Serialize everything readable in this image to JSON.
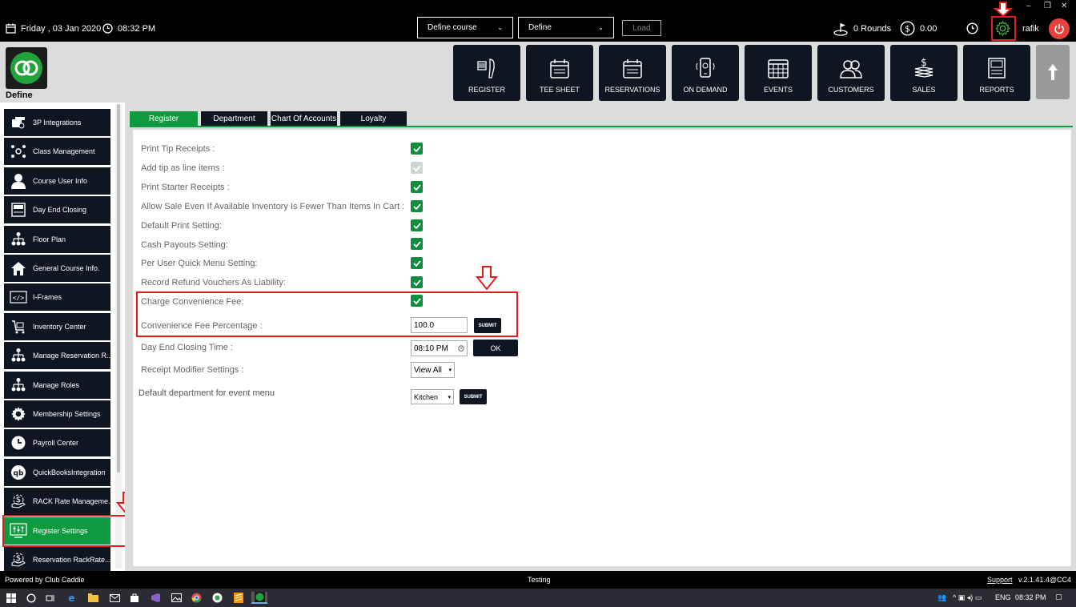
{
  "topbar": {
    "date": "Friday ,  03 Jan 2020",
    "time": "08:32 PM",
    "course_select": "Define  course",
    "define_select": "Define",
    "load_label": "Load",
    "rounds": "0 Rounds",
    "amount": "0.00",
    "user": "rafik"
  },
  "header": {
    "logo_label": "Define",
    "nav": [
      {
        "label": "REGISTER",
        "icon": "barcode-scanner-icon"
      },
      {
        "label": "TEE SHEET",
        "icon": "calendar-icon"
      },
      {
        "label": "RESERVATIONS",
        "icon": "calendar-icon"
      },
      {
        "label": "ON DEMAND",
        "icon": "mobile-icon"
      },
      {
        "label": "EVENTS",
        "icon": "events-calendar-icon"
      },
      {
        "label": "CUSTOMERS",
        "icon": "users-icon"
      },
      {
        "label": "SALES",
        "icon": "money-icon"
      },
      {
        "label": "REPORTS",
        "icon": "report-icon"
      }
    ]
  },
  "sidebar": {
    "items": [
      {
        "label": "3P Integrations",
        "icon": "integration-icon"
      },
      {
        "label": "Class Management",
        "icon": "class-icon"
      },
      {
        "label": "Course User Info",
        "icon": "user-icon"
      },
      {
        "label": "Day End Closing",
        "icon": "register-icon"
      },
      {
        "label": "Floor Plan",
        "icon": "hierarchy-icon"
      },
      {
        "label": "General Course Info.",
        "icon": "home-icon"
      },
      {
        "label": "I-Frames",
        "icon": "code-icon"
      },
      {
        "label": "Inventory Center",
        "icon": "inventory-icon"
      },
      {
        "label": "Manage Reservation R...",
        "icon": "hierarchy-icon"
      },
      {
        "label": "Manage Roles",
        "icon": "hierarchy-icon"
      },
      {
        "label": "Membership Settings",
        "icon": "gear-icon"
      },
      {
        "label": "Payroll Center",
        "icon": "clock-icon"
      },
      {
        "label": "QuickBooksIntegration",
        "icon": "quickbooks-icon"
      },
      {
        "label": "RACK Rate Manageme...",
        "icon": "money-hand-icon"
      },
      {
        "label": "Register Settings",
        "icon": "register-settings-icon"
      },
      {
        "label": "Reservation RackRate...",
        "icon": "money-hand-icon"
      }
    ]
  },
  "tabs": [
    "Register",
    "Department",
    "Chart Of Accounts",
    "Loyalty"
  ],
  "settings": {
    "print_tip_receipts": "Print Tip Receipts :",
    "add_tip_line_items": "Add tip as line items :",
    "print_starter_receipts": "Print Starter Receipts :",
    "allow_sale": "Allow Sale Even If Available Inventory Is Fewer Than Items In Cart :",
    "default_print": "Default Print Setting:",
    "cash_payouts": "Cash Payouts Setting:",
    "per_user_quick_menu": "Per User Quick Menu Setting:",
    "record_refund": "Record Refund Vouchers As Liability:",
    "charge_convenience_fee": "Charge Convenience Fee:",
    "convenience_fee_percentage": "Convenience Fee Percentage :",
    "convenience_fee_value": "100.0",
    "submit_label": "SUBMIT",
    "day_end_closing_time": "Day End Closing Time :",
    "day_end_time_value": "08:10 PM",
    "ok_label": "OK",
    "receipt_modifier": "Receipt Modifier Settings :",
    "receipt_modifier_value": "View All",
    "default_department": "Default department for event menu",
    "default_department_value": "Kitchen"
  },
  "footer": {
    "powered_by": "Powered by Club Caddie",
    "env": "Testing",
    "support": "Support",
    "version": "v.2.1.41.4@CC4"
  },
  "taskbar": {
    "lang": "ENG",
    "time": "08:32 PM"
  },
  "colors": {
    "accent_green": "#0e9a3e",
    "nav_dark": "#0f1622",
    "highlight_red": "#e31d1d",
    "power_red": "#e8413b"
  }
}
